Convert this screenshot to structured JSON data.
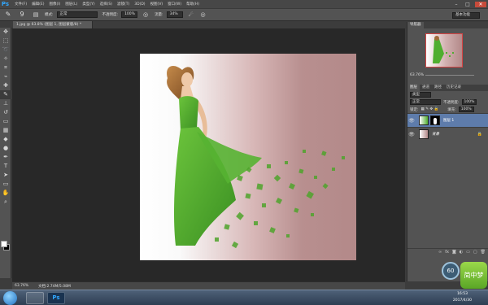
{
  "app": {
    "logo": "Ps",
    "menu": [
      "文件(F)",
      "编辑(E)",
      "图像(I)",
      "图层(L)",
      "类型(Y)",
      "选择(S)",
      "滤镜(T)",
      "3D(D)",
      "视图(V)",
      "窗口(W)",
      "帮助(H)"
    ]
  },
  "options": {
    "size_value": "9",
    "mode_label": "模式:",
    "mode_value": "正常",
    "opacity_label": "不透明度:",
    "opacity_value": "100%",
    "flow_label": "流量:",
    "flow_value": "34%",
    "workspace": "基本功能"
  },
  "document": {
    "tab_title": "1.jpg @ 63.8% (图层 1, 图层蒙版/8) *"
  },
  "status": {
    "zoom": "63.76%",
    "doc_info": "文档:2.74M/5.08M"
  },
  "navigator": {
    "tabs": [
      "导航器"
    ],
    "zoom": "63.76%"
  },
  "layers_panel": {
    "tabs": [
      "图层",
      "通道",
      "路径",
      "历史记录"
    ],
    "filter_label": "类型",
    "blend_mode": "正常",
    "opacity_label": "不透明度:",
    "opacity_value": "100%",
    "lock_label": "锁定:",
    "fill_label": "填充:",
    "fill_value": "100%",
    "layers": [
      {
        "name": "图层 1",
        "selected": true
      },
      {
        "name": "背景",
        "selected": false
      }
    ]
  },
  "taskbar": {
    "time": "16:53",
    "date": "2017/4/30"
  },
  "widgets": {
    "speed_value": "60",
    "badge_text": "简中梦"
  },
  "colors": {
    "accent_selected": "#5e7cab",
    "ps_blue": "#31a8ff",
    "dress_green": "#4fae2f"
  }
}
